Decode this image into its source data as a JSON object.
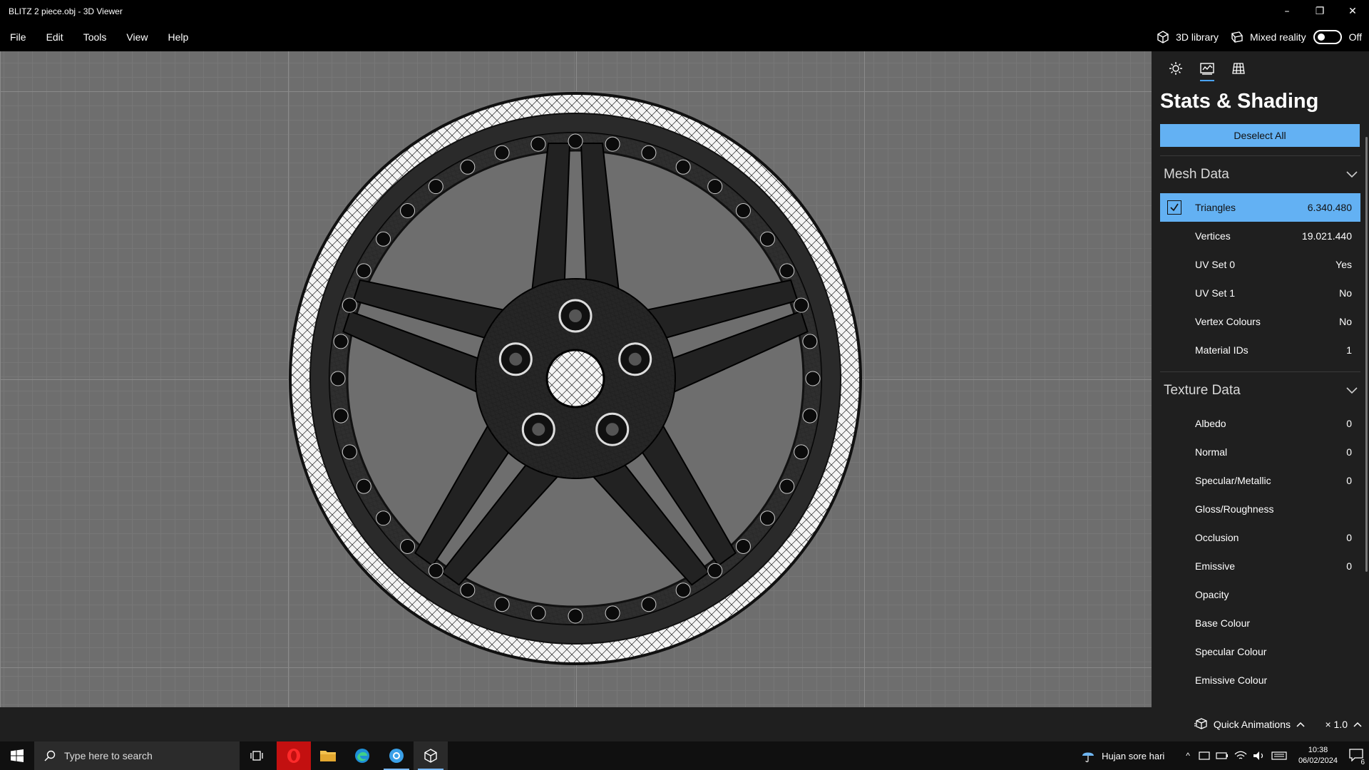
{
  "window": {
    "title": "BLITZ 2 piece.obj - 3D Viewer"
  },
  "menu": {
    "items": [
      "File",
      "Edit",
      "Tools",
      "View",
      "Help"
    ],
    "library_label": "3D library",
    "mixed_reality_label": "Mixed reality",
    "mixed_reality_state": "Off"
  },
  "panel": {
    "title": "Stats & Shading",
    "deselect_label": "Deselect All",
    "mesh_header": "Mesh Data",
    "mesh_rows": [
      {
        "label": "Triangles",
        "value": "6.340.480",
        "selected": true
      },
      {
        "label": "Vertices",
        "value": "19.021.440"
      },
      {
        "label": "UV Set 0",
        "value": "Yes"
      },
      {
        "label": "UV Set 1",
        "value": "No"
      },
      {
        "label": "Vertex Colours",
        "value": "No"
      },
      {
        "label": "Material IDs",
        "value": "1"
      }
    ],
    "texture_header": "Texture Data",
    "texture_rows": [
      {
        "label": "Albedo",
        "value": "0"
      },
      {
        "label": "Normal",
        "value": "0"
      },
      {
        "label": "Specular/Metallic",
        "value": "0"
      },
      {
        "label": "Gloss/Roughness",
        "value": ""
      },
      {
        "label": "Occlusion",
        "value": "0"
      },
      {
        "label": "Emissive",
        "value": "0"
      },
      {
        "label": "Opacity",
        "value": ""
      },
      {
        "label": "Base Colour",
        "value": ""
      },
      {
        "label": "Specular Colour",
        "value": ""
      },
      {
        "label": "Emissive Colour",
        "value": ""
      }
    ]
  },
  "bottom": {
    "quick_animations": "Quick Animations",
    "zoom": "× 1.0"
  },
  "taskbar": {
    "search_placeholder": "Type here to search",
    "weather": "Hujan sore hari",
    "time": "10:38",
    "date": "06/02/2024",
    "notifications": "6"
  },
  "colors": {
    "accent": "#63b1f3",
    "background": "#1f1f1f",
    "viewport": "#6e6e6e"
  }
}
